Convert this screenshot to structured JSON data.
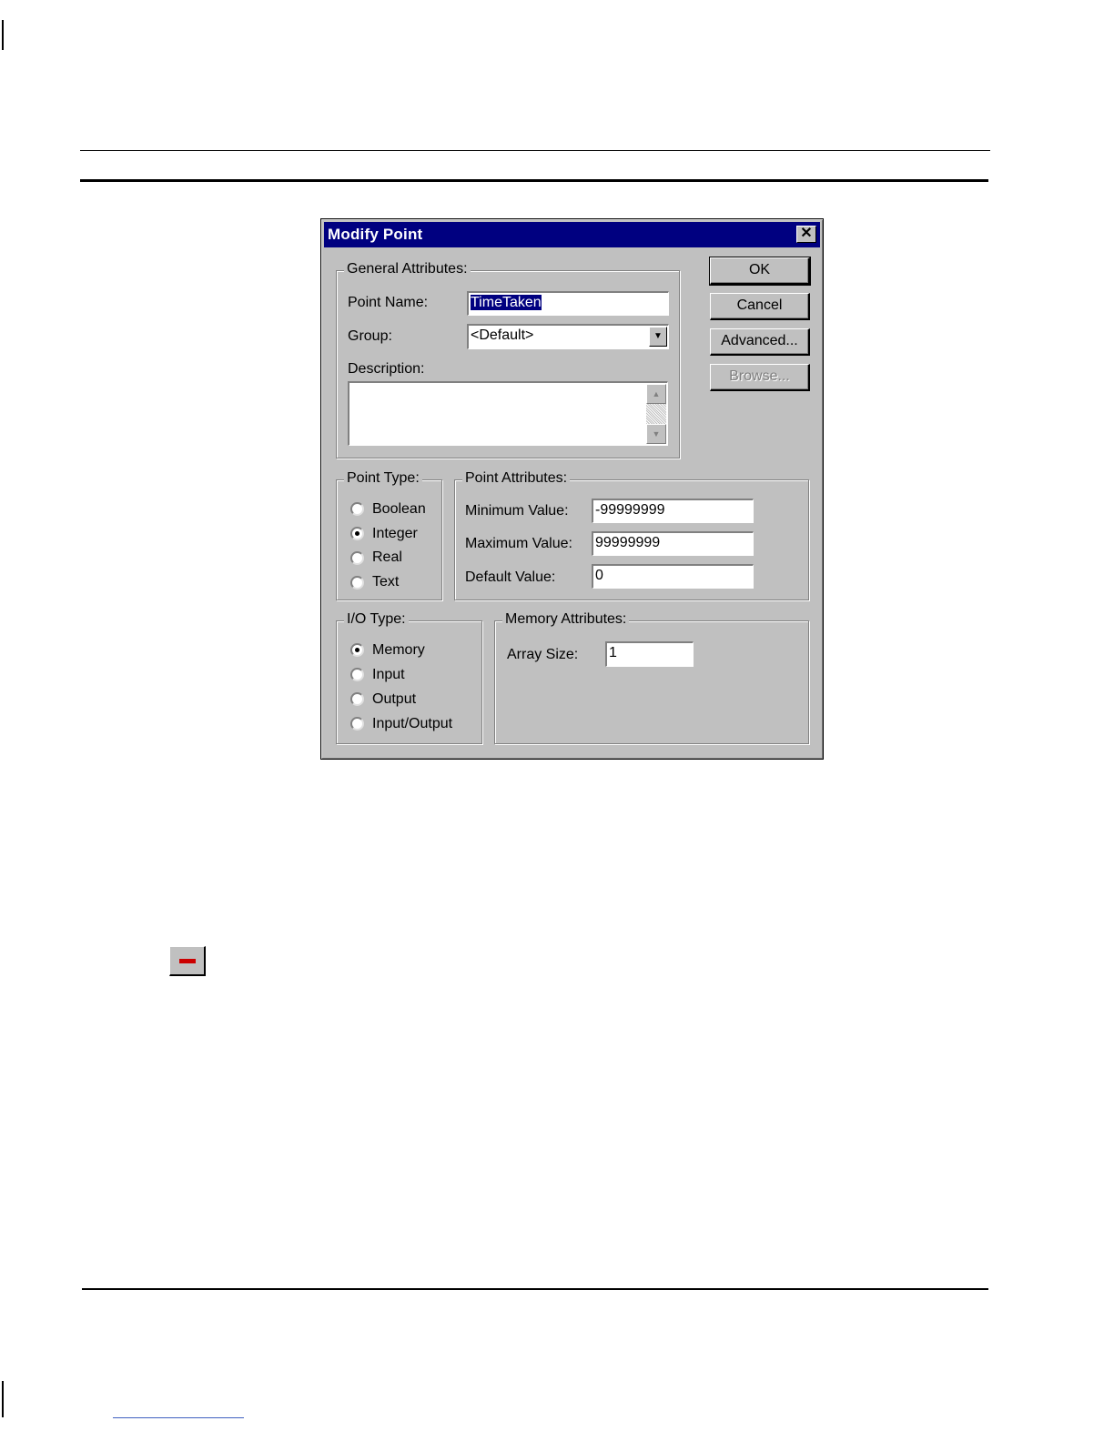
{
  "dialog": {
    "title": "Modify Point",
    "close_glyph": "✕",
    "general": {
      "label": "General Attributes:",
      "point_name_label": "Point Name:",
      "point_name_value": "TimeTaken",
      "group_label": "Group:",
      "group_value": "<Default>",
      "description_label": "Description:",
      "description_value": ""
    },
    "buttons": {
      "ok": "OK",
      "cancel": "Cancel",
      "advanced": "Advanced...",
      "browse": "Browse..."
    },
    "point_type": {
      "label": "Point Type:",
      "options": [
        "Boolean",
        "Integer",
        "Real",
        "Text"
      ],
      "selected": "Integer"
    },
    "point_attributes": {
      "label": "Point Attributes:",
      "min_label": "Minimum Value:",
      "min_value": "-99999999",
      "max_label": "Maximum Value:",
      "max_value": "99999999",
      "default_label": "Default Value:",
      "default_value": "0"
    },
    "io_type": {
      "label": "I/O Type:",
      "options": [
        "Memory",
        "Input",
        "Output",
        "Input/Output"
      ],
      "selected": "Memory"
    },
    "memory_attributes": {
      "label": "Memory Attributes:",
      "array_size_label": "Array Size:",
      "array_size_value": "1"
    }
  },
  "icons": {
    "combo_arrow": "combo-arrow-icon",
    "scroll_up": "scroll-up-icon",
    "scroll_down": "scroll-down-icon",
    "collapse": "minus-icon"
  },
  "colors": {
    "title_bar": "#000080",
    "dialog_face": "#c0c0c0",
    "minus_icon": "#cc0000"
  }
}
